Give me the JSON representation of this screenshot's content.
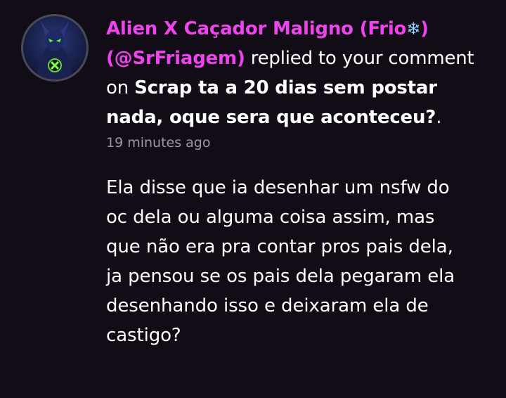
{
  "notification": {
    "user_name": "Alien X Caçador Maligno (Frio",
    "user_name_emoji": "❄",
    "user_name_close": ")",
    "user_handle": "(@SrFriagem)",
    "action_text": " replied to your comment on ",
    "post_title": "Scrap ta a 20 dias sem postar nada, oque sera que aconteceu?",
    "post_title_end": ".",
    "timestamp": "19 minutes ago",
    "reply_text": "Ela disse que ia desenhar um nsfw do oc dela ou alguma coisa assim, mas que não era pra contar pros pais dela, ja pensou se os pais dela pegaram ela desenhando isso e deixaram ela de castigo?"
  },
  "avatar": {
    "icon": "alien-avatar-icon"
  },
  "colors": {
    "background": "#120c16",
    "username": "#ee44ee",
    "timestamp": "#9c98a0",
    "text": "#ffffff"
  }
}
